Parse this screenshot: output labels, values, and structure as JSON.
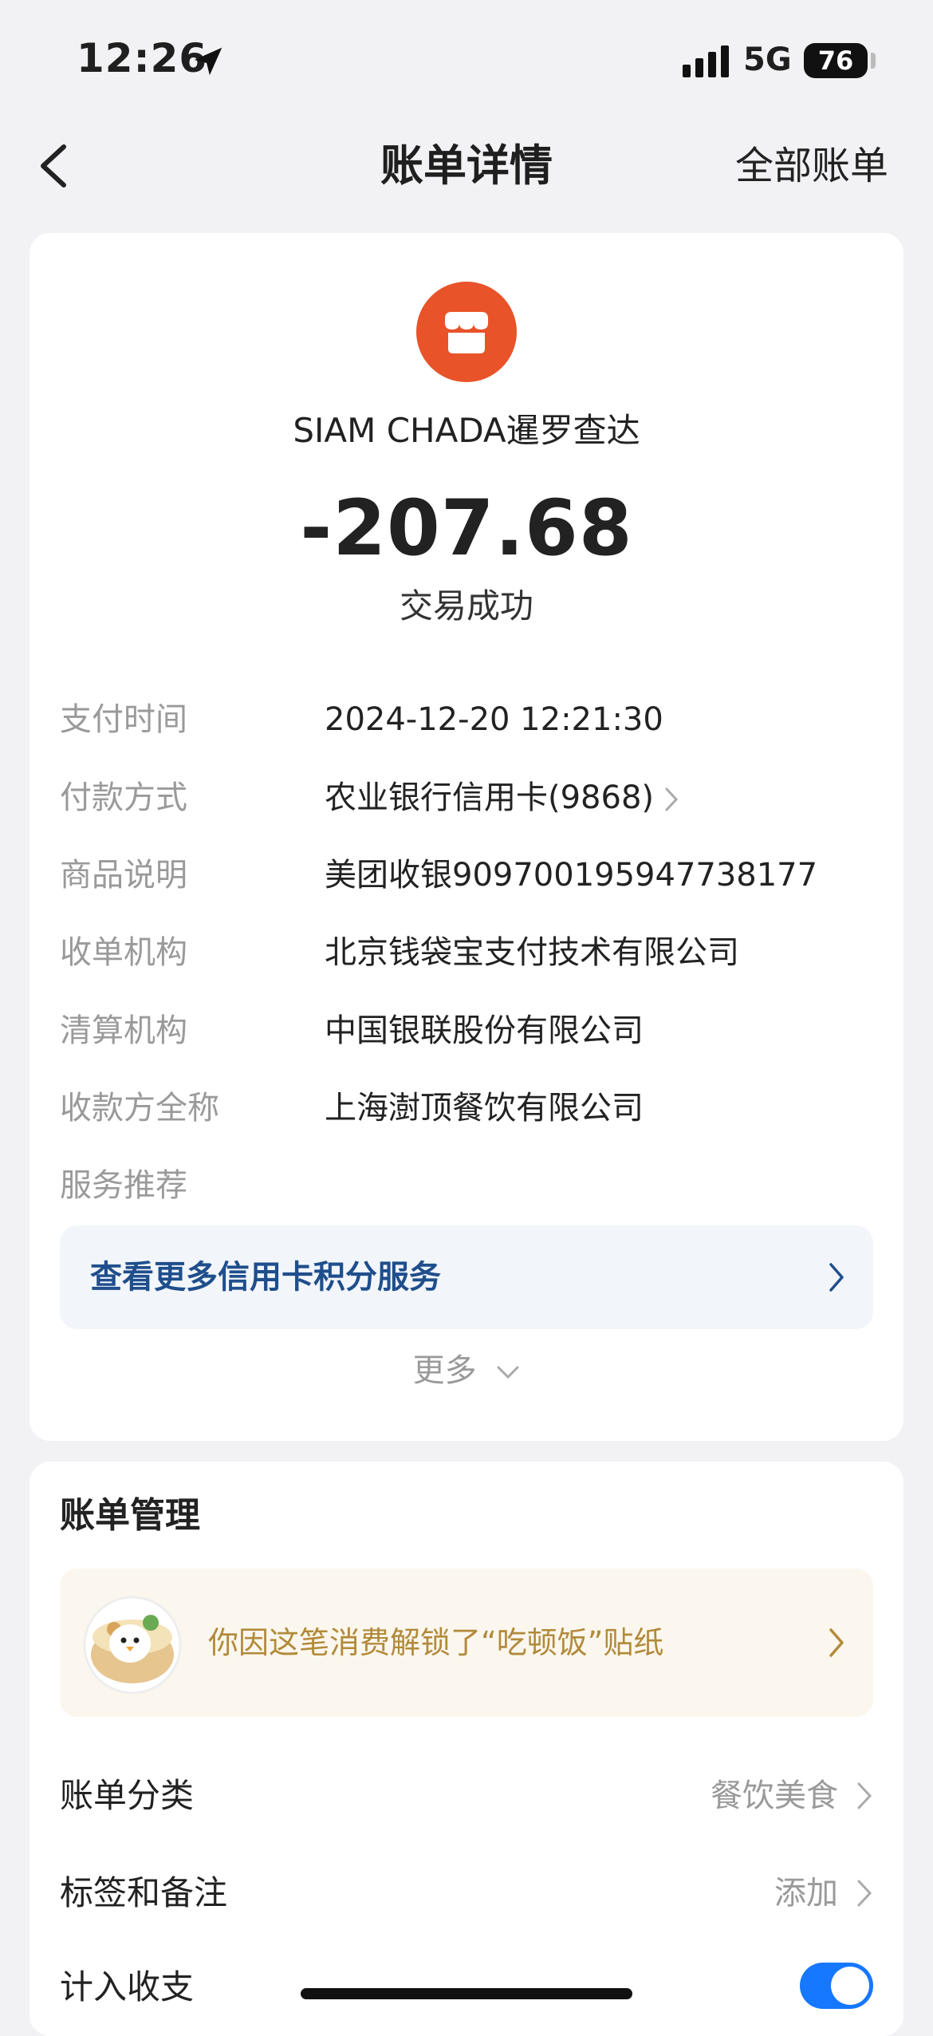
{
  "status_bar": {
    "time": "12:26",
    "network": "5G",
    "battery": "76",
    "icons": [
      "location-arrow-icon",
      "signal-icon",
      "battery-icon"
    ]
  },
  "nav": {
    "back_icon": "chevron-left-icon",
    "title": "账单详情",
    "right_action": "全部账单"
  },
  "transaction": {
    "merchant_icon": "storefront-icon",
    "merchant_icon_color": "#e8532a",
    "merchant": "SIAM CHADA暹罗查达",
    "amount": "-207.68",
    "status": "交易成功",
    "details": [
      {
        "label": "支付时间",
        "value": "2024-12-20 12:21:30"
      },
      {
        "label": "付款方式",
        "value": "农业银行信用卡(9868)"
      },
      {
        "label": "商品说明",
        "value": "美团收银909700195947738177"
      },
      {
        "label": "收单机构",
        "value": "北京钱袋宝支付技术有限公司"
      },
      {
        "label": "清算机构",
        "value": "中国银联股份有限公司"
      },
      {
        "label": "收款方全称",
        "value": "上海澍顶餐饮有限公司"
      },
      {
        "label": "服务推荐",
        "value": ""
      }
    ],
    "promo": "查看更多信用卡积分服务",
    "more": "更多"
  },
  "management": {
    "title": "账单管理",
    "sticker_text": "你因这笔消费解锁了“吃顿饭”贴纸",
    "sticker_icon": "bowl-sticker-icon",
    "category_label": "账单分类",
    "category_value": "餐饮美食",
    "tags_label": "标签和备注",
    "tags_value": "添加",
    "include_label": "计入收支",
    "include_enabled": true
  },
  "colors": {
    "accent": "#1677ff",
    "promo_text": "#1f4e8c",
    "sticker_text": "#b28a3a",
    "background": "#f2f2f4"
  }
}
